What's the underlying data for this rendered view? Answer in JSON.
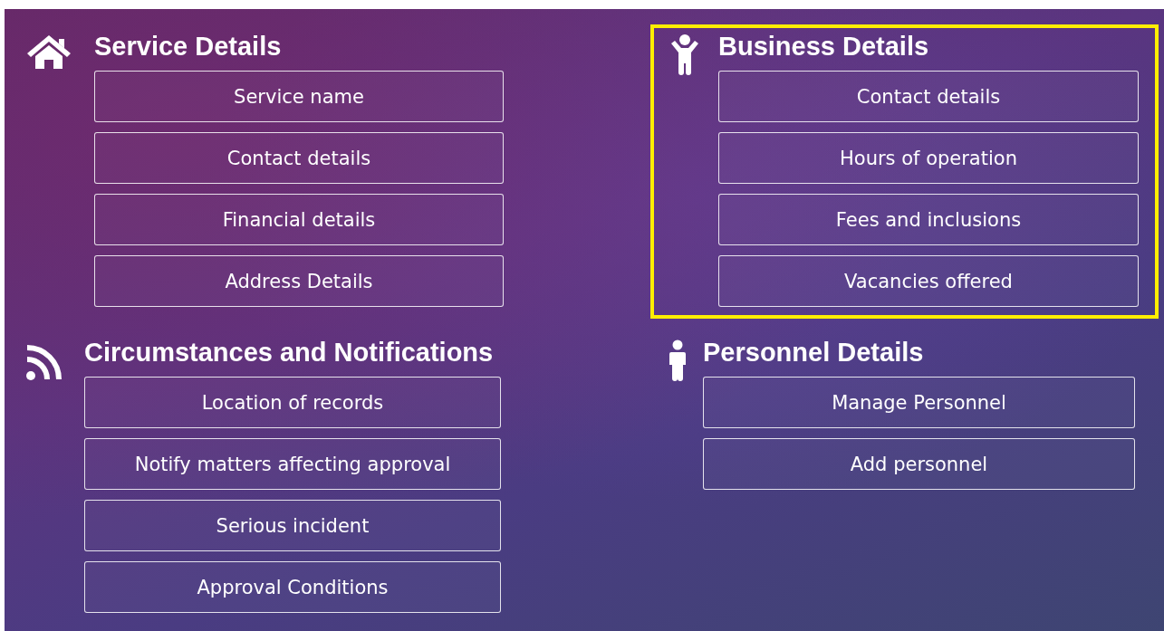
{
  "sections": [
    {
      "title": "Service Details",
      "highlighted": false,
      "buttons": [
        "Service name",
        "Contact details",
        "Financial details",
        "Address Details"
      ]
    },
    {
      "title": "Business Details",
      "highlighted": true,
      "buttons": [
        "Contact details",
        "Hours of operation",
        "Fees and inclusions",
        "Vacancies offered"
      ]
    },
    {
      "title": "Circumstances and Notifications",
      "highlighted": false,
      "buttons": [
        "Location of records",
        "Notify matters affecting approval",
        "Serious incident",
        "Approval Conditions"
      ]
    },
    {
      "title": "Personnel Details",
      "highlighted": false,
      "buttons": [
        "Manage Personnel",
        "Add personnel"
      ]
    }
  ]
}
